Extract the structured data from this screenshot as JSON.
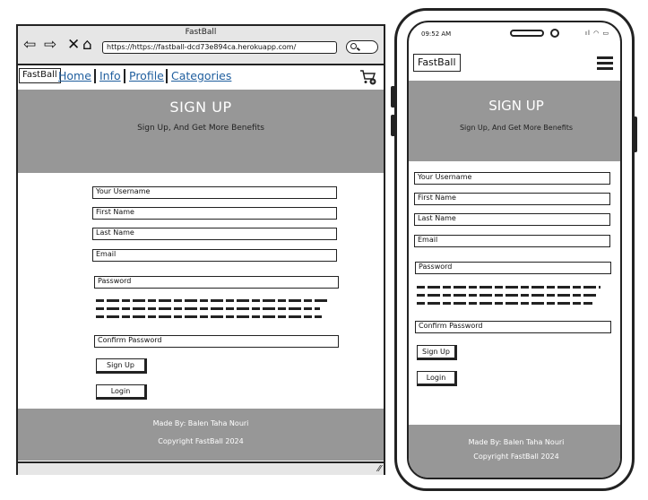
{
  "browser": {
    "window_title": "FastBall",
    "url": "https://https://fastball-dcd73e894ca.herokuapp.com/"
  },
  "site": {
    "brand": "FastBall",
    "nav": [
      "Home",
      "Info",
      "Profile",
      "Categories"
    ],
    "hero_title": "SIGN UP",
    "hero_subtitle": "Sign Up, And Get More Benefits",
    "form": {
      "username_placeholder": "Your Username",
      "first_name_placeholder": "First Name",
      "last_name_placeholder": "Last Name",
      "email_placeholder": "Email",
      "password_placeholder": "Password",
      "confirm_password_placeholder": "Confirm Password",
      "signup_label": "Sign Up",
      "login_label": "Login"
    },
    "footer": {
      "made_by": "Made By: Balen Taha Nouri",
      "copyright": "Copyright FastBall 2024"
    }
  },
  "phone": {
    "time": "09:52 AM"
  },
  "icons": [
    "back-arrow-icon",
    "forward-arrow-icon",
    "close-icon",
    "home-icon",
    "search-icon",
    "cart-icon",
    "hamburger-menu-icon",
    "signal-icon",
    "wifi-icon",
    "battery-icon",
    "resize-grip-icon"
  ],
  "colors": {
    "hero_background": "#979797",
    "link": "#1f5e9e",
    "chrome": "#e6e6e6"
  }
}
